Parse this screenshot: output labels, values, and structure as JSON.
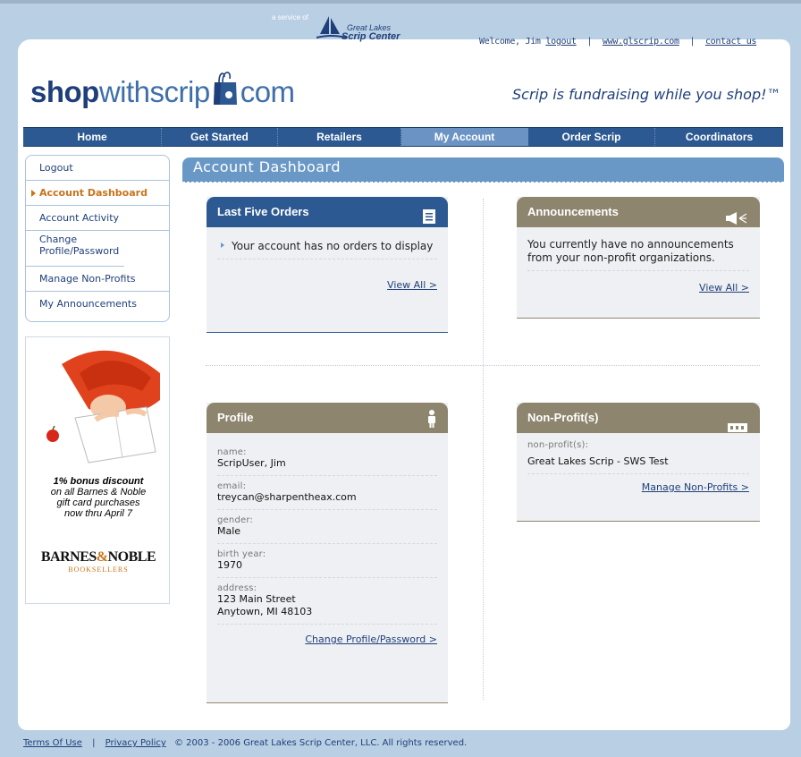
{
  "service": {
    "a_service_of": "a service of",
    "org_line1": "Great Lakes",
    "org_line2": "Scrip Center"
  },
  "top_links": {
    "welcome": "Welcome, Jim",
    "logout": "logout",
    "site": "www.glscrip.com",
    "contact": "contact us",
    "separator": "|"
  },
  "logo": {
    "shop": "shop",
    "with": "withscrip",
    "com": "com"
  },
  "tagline": "Scrip is fundraising while you shop!™",
  "nav": {
    "items": [
      {
        "label": "Home"
      },
      {
        "label": "Get Started"
      },
      {
        "label": "Retailers"
      },
      {
        "label": "My Account",
        "active": true
      },
      {
        "label": "Order Scrip"
      },
      {
        "label": "Coordinators"
      }
    ]
  },
  "sidebar": {
    "items": [
      {
        "label": "Logout"
      },
      {
        "label": "Account Dashboard",
        "active": true
      },
      {
        "label": "Account Activity"
      },
      {
        "label": "Change Profile/Password"
      },
      {
        "label": "Manage Non-Profits"
      },
      {
        "label": "My Announcements"
      }
    ]
  },
  "ad": {
    "line1": "1% bonus discount",
    "line2": "on all Barnes & Noble",
    "line3": "gift card purchases",
    "line4": "now thru April 7",
    "brand_a": "BARNES",
    "brand_amp": "&",
    "brand_b": "NOBLE",
    "brand_sub": "BOOKSELLERS"
  },
  "main": {
    "title": "Account Dashboard"
  },
  "orders": {
    "title": "Last Five Orders",
    "empty": "Your account has no orders to display",
    "link": "View All >"
  },
  "announcements": {
    "title": "Announcements",
    "text": "You currently have no announcements from your non-profit organizations.",
    "link": "View All >"
  },
  "profile": {
    "title": "Profile",
    "name_label": "name:",
    "name": "ScripUser, Jim",
    "email_label": "email:",
    "email": "treycan@sharpentheax.com",
    "gender_label": "gender:",
    "gender": "Male",
    "birth_label": "birth year:",
    "birth": "1970",
    "address_label": "address:",
    "address1": "123 Main Street",
    "address2": "Anytown, MI 48103",
    "link": "Change Profile/Password >"
  },
  "nonprofits": {
    "title": "Non-Profit(s)",
    "label": "non-profit(s):",
    "value": "Great Lakes Scrip - SWS Test",
    "link": "Manage Non-Profits >"
  },
  "footer": {
    "terms": "Terms Of Use",
    "separator": "|",
    "privacy": "Privacy Policy",
    "copyright": "© 2003 - 2006 Great Lakes Scrip Center, LLC. All rights reserved."
  },
  "colors": {
    "brand_blue": "#2d5992",
    "light_blue": "#6a98c6",
    "tan": "#8e856f",
    "accent_orange": "#c8741b",
    "background": "#b9cfe4"
  }
}
